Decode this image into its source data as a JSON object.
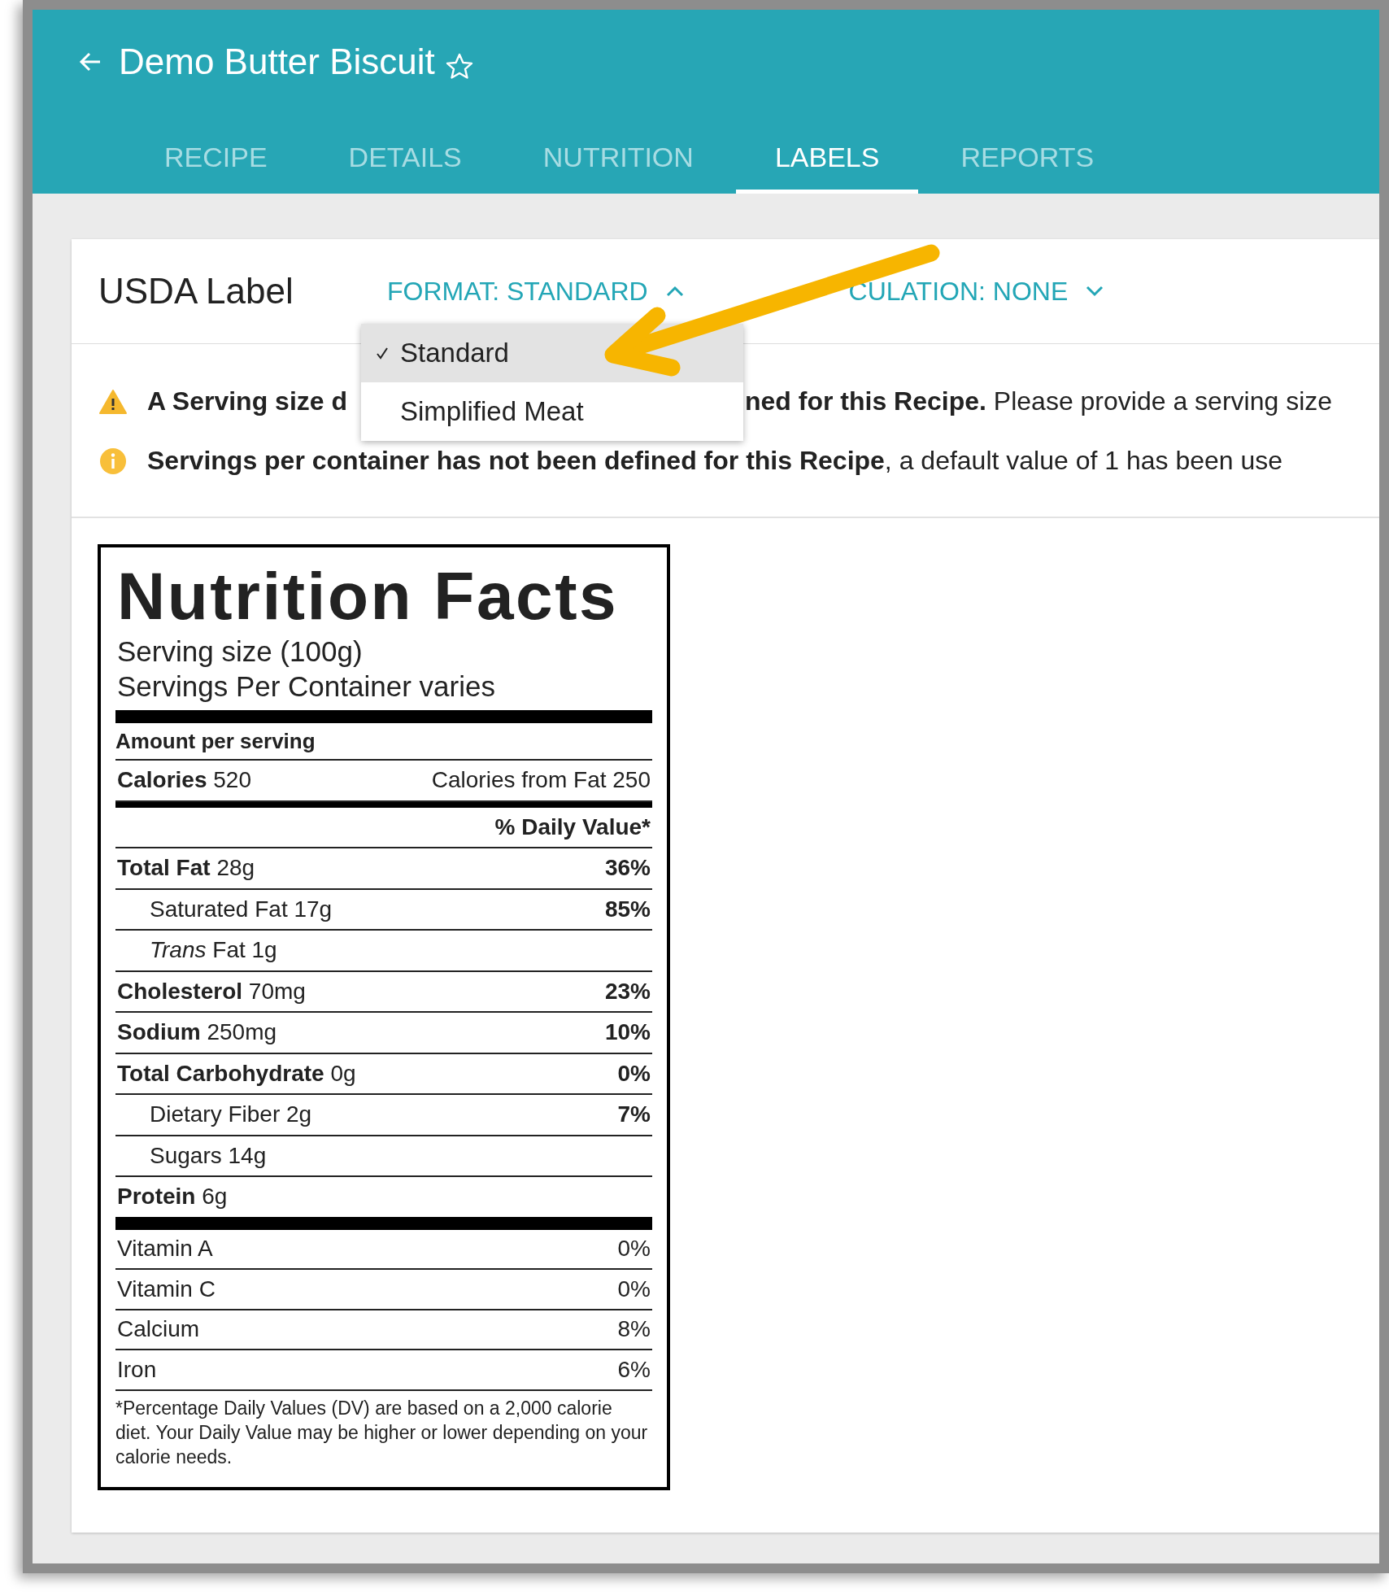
{
  "header": {
    "title": "Demo Butter Biscuit",
    "starred": false
  },
  "tabs": [
    {
      "label": "RECIPE",
      "selected": false
    },
    {
      "label": "DETAILS",
      "selected": false
    },
    {
      "label": "NUTRITION",
      "selected": false
    },
    {
      "label": "LABELS",
      "selected": true
    },
    {
      "label": "REPORTS",
      "selected": false
    }
  ],
  "card": {
    "title": "USDA Label",
    "format": {
      "label": "FORMAT: STANDARD",
      "expanded": true,
      "options": [
        {
          "label": "Standard",
          "selected": true
        },
        {
          "label": "Simplified Meat",
          "selected": false
        }
      ]
    },
    "calculation": {
      "label": "CULATION: NONE",
      "expanded": false
    },
    "messages": [
      {
        "kind": "warning",
        "before_menu": "**A Serving size d**",
        "after_menu": "**ned for this Recipe.** Please provide a serving size"
      },
      {
        "kind": "info",
        "text": "**Servings per container has not been defined for this Recipe**, a default value of 1 has been use"
      }
    ]
  },
  "label": {
    "title": "Nutrition Facts",
    "serving_size": "Serving size (100g)",
    "servings": "Servings Per Container varies",
    "amount_heading": "Amount per serving",
    "calories_label": "Calories",
    "calories": "520",
    "calories_from_fat": "Calories from Fat 250",
    "dv_heading": "% Daily Value*",
    "nutrients": [
      {
        "kind": "main",
        "name": "Total Fat",
        "amount": "28g",
        "dv": "36%"
      },
      {
        "kind": "sub",
        "name": "Saturated Fat",
        "amount": "17g",
        "dv": "85%"
      },
      {
        "kind": "sub",
        "name": "*Trans* Fat",
        "amount": "1g"
      },
      {
        "kind": "main",
        "name": "Cholesterol",
        "amount": "70mg",
        "dv": "23%"
      },
      {
        "kind": "main",
        "name": "Sodium",
        "amount": "250mg",
        "dv": "10%"
      },
      {
        "kind": "main",
        "name": "Total Carbohydrate",
        "amount": "0g",
        "dv": "0%"
      },
      {
        "kind": "sub",
        "name": "Dietary Fiber",
        "amount": "2g",
        "dv": "7%"
      },
      {
        "kind": "sub",
        "name": "Sugars",
        "amount": "14g"
      },
      {
        "kind": "main",
        "name": "Protein",
        "amount": "6g"
      }
    ],
    "vitamins": [
      {
        "name": "Vitamin A",
        "dv": "0%"
      },
      {
        "name": "Vitamin C",
        "dv": "0%"
      },
      {
        "name": "Calcium",
        "dv": "8%"
      },
      {
        "name": "Iron",
        "dv": "6%"
      }
    ],
    "footnote": "*Percentage Daily Values (DV) are based on a 2,000 calorie diet. Your Daily Value may be higher or lower depending on your calorie needs."
  }
}
